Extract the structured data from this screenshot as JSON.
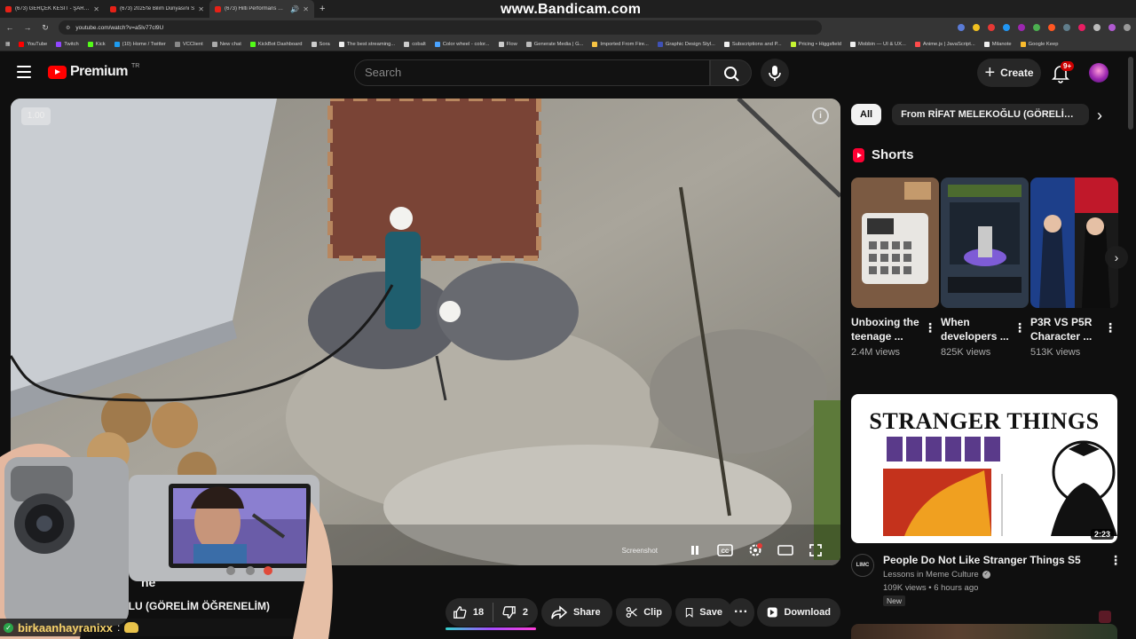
{
  "browser": {
    "tabs": [
      {
        "label": "(673) GERÇEK KESİT - ŞARKICI",
        "active": false
      },
      {
        "label": "(673) 2025'te Bilim Dünyasını S",
        "active": false
      },
      {
        "label": "(673) Hilti Performans Dene",
        "active": true
      }
    ],
    "url": "youtube.com/watch?v=a5lv77cl9U",
    "bookmarks": [
      {
        "label": "YouTube",
        "color": "#ff0000"
      },
      {
        "label": "Twitch",
        "color": "#9146ff"
      },
      {
        "label": "Kick",
        "color": "#53fc18"
      },
      {
        "label": "(10) Home / Twitter",
        "color": "#1d9bf0"
      },
      {
        "label": "VCClient",
        "color": "#888888"
      },
      {
        "label": "New chat",
        "color": "#aaaaaa"
      },
      {
        "label": "KickBot Dashboard",
        "color": "#53fc18"
      },
      {
        "label": "Sora",
        "color": "#cccccc"
      },
      {
        "label": "The best streaming...",
        "color": "#eeeeee"
      },
      {
        "label": "cobalt",
        "color": "#cccccc"
      },
      {
        "label": "Color wheel - color...",
        "color": "#4aa3ff"
      },
      {
        "label": "Flow",
        "color": "#cccccc"
      },
      {
        "label": "Generate Media | G...",
        "color": "#bbbbbb"
      },
      {
        "label": "Imported From Fire...",
        "color": "#f6c343"
      },
      {
        "label": "Graphic Design Styl...",
        "color": "#3f51b5"
      },
      {
        "label": "Subscriptions and P...",
        "color": "#eeeeee"
      },
      {
        "label": "Pricing • Higgsfield",
        "color": "#c6f432"
      },
      {
        "label": "Mobbin — UI & UX...",
        "color": "#eeeeee"
      },
      {
        "label": "Anime.js | JavaScript...",
        "color": "#ff4b4b"
      },
      {
        "label": "Milanote",
        "color": "#eeeeee"
      },
      {
        "label": "Google Keep",
        "color": "#f9bb2d"
      }
    ]
  },
  "watermark": "www.Bandicam.com",
  "header": {
    "logo_text": "Premium",
    "logo_region": "TR",
    "search_placeholder": "Search",
    "create_label": "Create",
    "notification_count": "9+"
  },
  "player": {
    "speed_label": "1.00",
    "screenshot_label": "Screenshot",
    "info_icon": "info-icon"
  },
  "video": {
    "title_fragment": "ne",
    "channel_fragment": "OĞLU (GÖRELİM ÖĞRENELİM)",
    "likes": "18",
    "like_fraction": 0.9,
    "dislikes": "2",
    "share_label": "Share",
    "clip_label": "Clip",
    "save_label": "Save",
    "download_label": "Download"
  },
  "chat_overlay": {
    "user": "birkaanhayranixx",
    "separator": ":"
  },
  "sidebar": {
    "chips": [
      "All",
      "From RİFAT MELEKOĞLU (GÖRELİM ÖĞRENEL"
    ],
    "shorts_heading": "Shorts",
    "shorts": [
      {
        "title": "Unboxing the teenage ...",
        "views": "2.4M views"
      },
      {
        "title": "When developers ...",
        "views": "825K views"
      },
      {
        "title": "P3R VS P5R Character ...",
        "views": "513K views"
      }
    ],
    "recommended": {
      "thumb_text": "STRANGER THINGS",
      "duration": "2:23",
      "channel_avatar_text": "LIMC",
      "title": "People Do Not Like Stranger Things S5",
      "channel": "Lessons in Meme Culture",
      "views": "109K views",
      "age": "6 hours ago",
      "badge": "New"
    }
  }
}
